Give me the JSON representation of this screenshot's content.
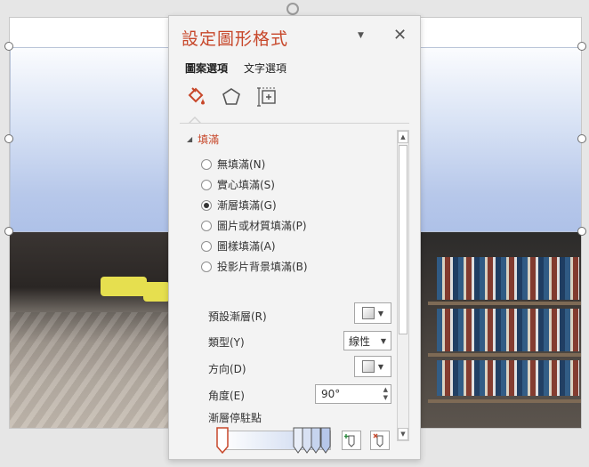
{
  "pane": {
    "title": "設定圖形格式",
    "tabs": [
      "圖案選項",
      "文字選項"
    ],
    "icons": [
      "fill-line-icon",
      "effects-pentagon-icon",
      "size-properties-icon"
    ]
  },
  "fill": {
    "section_title": "填滿",
    "options": [
      {
        "label": "無填滿(N)",
        "checked": false
      },
      {
        "label": "實心填滿(S)",
        "checked": false
      },
      {
        "label": "漸層填滿(G)",
        "checked": true
      },
      {
        "label": "圖片或材質填滿(P)",
        "checked": false
      },
      {
        "label": "圖樣填滿(A)",
        "checked": false
      },
      {
        "label": "投影片背景填滿(B)",
        "checked": false
      }
    ],
    "preset_gradient_label": "預設漸層(R)",
    "type_label": "類型(Y)",
    "type_value": "線性",
    "direction_label": "方向(D)",
    "angle_label": "角度(E)",
    "angle_value": "90°",
    "gradient_stops_label": "漸層停駐點"
  },
  "colors": {
    "accent": "#c7472a",
    "gradient_top": "#fbfcfe",
    "gradient_bottom": "#aec1e8"
  }
}
